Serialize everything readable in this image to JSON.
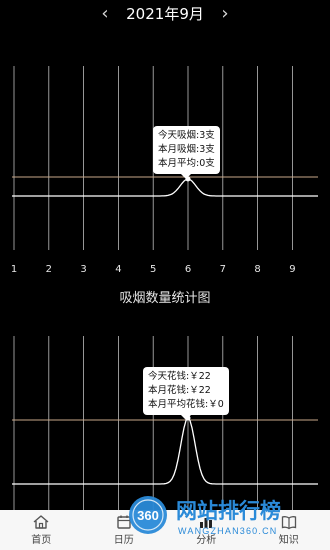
{
  "header": {
    "month": "2021年9月",
    "prev_icon": "chevron-left-icon",
    "next_icon": "chevron-right-icon"
  },
  "smoke_chart": {
    "title": "吸烟数量统计图",
    "days": [
      "1",
      "2",
      "3",
      "4",
      "5",
      "6",
      "7",
      "8",
      "9"
    ],
    "highlight_day": "6",
    "tooltip": {
      "lines": [
        {
          "label": "今天吸烟:",
          "value": "3支"
        },
        {
          "label": "本月吸烟:",
          "value": "3支"
        },
        {
          "label": "本月平均:",
          "value": "0支"
        }
      ]
    }
  },
  "spend_chart": {
    "highlight_day": "6",
    "tooltip": {
      "lines": [
        {
          "label": "今天花钱:",
          "value": "￥22"
        },
        {
          "label": "本月花钱:",
          "value": "￥22"
        },
        {
          "label": "本月平均花钱:",
          "value": "￥0"
        }
      ]
    }
  },
  "tabs": [
    {
      "label": "首页",
      "icon": "home-icon"
    },
    {
      "label": "日历",
      "icon": "calendar-icon"
    },
    {
      "label": "分析",
      "icon": "chart-icon"
    },
    {
      "label": "知识",
      "icon": "book-icon"
    }
  ],
  "watermark": {
    "badge": "360",
    "title": "网站排行榜",
    "url": "WANGZHAN360.CN"
  },
  "colors": {
    "background": "#000000",
    "grid": "#bdbdbd",
    "reference_line": "#c9a98a",
    "curve": "#ffffff",
    "watermark_blue": "#2a8ad8"
  }
}
